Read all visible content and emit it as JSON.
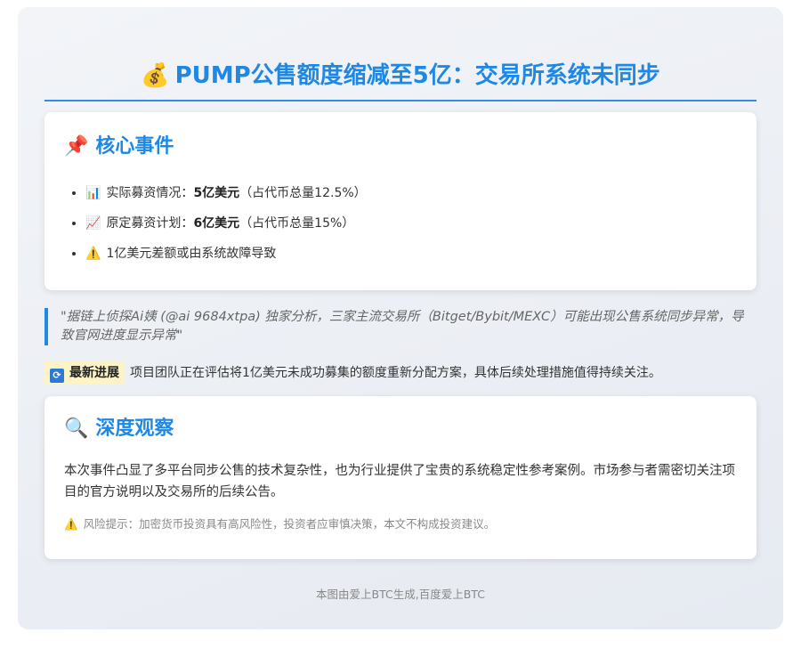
{
  "header": {
    "icon": "money-bag-icon",
    "icon_glyph": "💰",
    "title": "PUMP公售额度缩减至5亿：交易所系统未同步"
  },
  "core": {
    "icon_glyph": "📌",
    "title": "核心事件",
    "items": [
      {
        "icon_glyph": "📊",
        "label": "实际募资情况：",
        "value": "5亿美元",
        "note": "（占代币总量12.5%）"
      },
      {
        "icon_glyph": "📈",
        "label": "原定募资计划：",
        "value": "6亿美元",
        "note": "（占代币总量15%）"
      },
      {
        "icon_glyph": "⚠️",
        "label": "1亿美元差额或由系统故障导致",
        "value": "",
        "note": ""
      }
    ]
  },
  "quote": {
    "text": "\"据链上侦探Ai姨 (@ai 9684xtpa) 独家分析，三家主流交易所（Bitget/Bybit/MEXC）可能出现公售系统同步异常，导致官网进度显示异常\""
  },
  "progress": {
    "icon_glyph": "🔄",
    "tag": "最新进展",
    "text": "项目团队正在评估将1亿美元未成功募集的额度重新分配方案，具体后续处理措施值得持续关注。"
  },
  "deep": {
    "icon_glyph": "🔍",
    "title": "深度观察",
    "body": "本次事件凸显了多平台同步公售的技术复杂性，也为行业提供了宝贵的系统稳定性参考案例。市场参与者需密切关注项目的官方说明以及交易所的后续公告。",
    "risk_icon_glyph": "⚠️",
    "risk": "风险提示：加密货币投资具有高风险性，投资者应审慎决策，本文不构成投资建议。"
  },
  "footer": {
    "text": "本图由爱上BTC生成,百度爱上BTC"
  },
  "colors": {
    "accent": "#1e88e5",
    "highlight": "#fdf3c7"
  }
}
